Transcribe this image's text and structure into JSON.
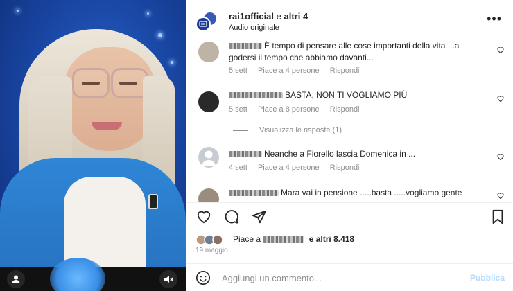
{
  "header": {
    "account": "rai1official",
    "connector": "e",
    "others": "altri 4",
    "subtitle": "Audio originale"
  },
  "comments": [
    {
      "text": "È tempo di pensare alle cose importanti della vita ...a godersi il tempo che abbiamo davanti...",
      "time": "5 sett",
      "likes": "Piace a 4 persone",
      "reply": "Rispondi"
    },
    {
      "text": "BASTA, NON TI VOGLIAMO PIÙ",
      "time": "5 sett",
      "likes": "Piace a 8 persone",
      "reply": "Rispondi",
      "view_replies": "Visualizza le risposte (1)"
    },
    {
      "text": "Neanche a Fiorello lascia Domenica in ...",
      "time": "4 sett",
      "likes": "Piace a 4 persone",
      "reply": "Rispondi"
    },
    {
      "text": "Mara vai in pensione .....basta .....vogliamo gente"
    }
  ],
  "post": {
    "likes_prefix": "Piace a",
    "likes_suffix": "e altri 8.418",
    "date": "19 maggio"
  },
  "comment_box": {
    "placeholder": "Aggiungi un commento...",
    "publish": "Pubblica"
  },
  "colors": {
    "accent_disabled": "#b3dbff",
    "text": "#262626",
    "muted": "#8e8e8e"
  }
}
